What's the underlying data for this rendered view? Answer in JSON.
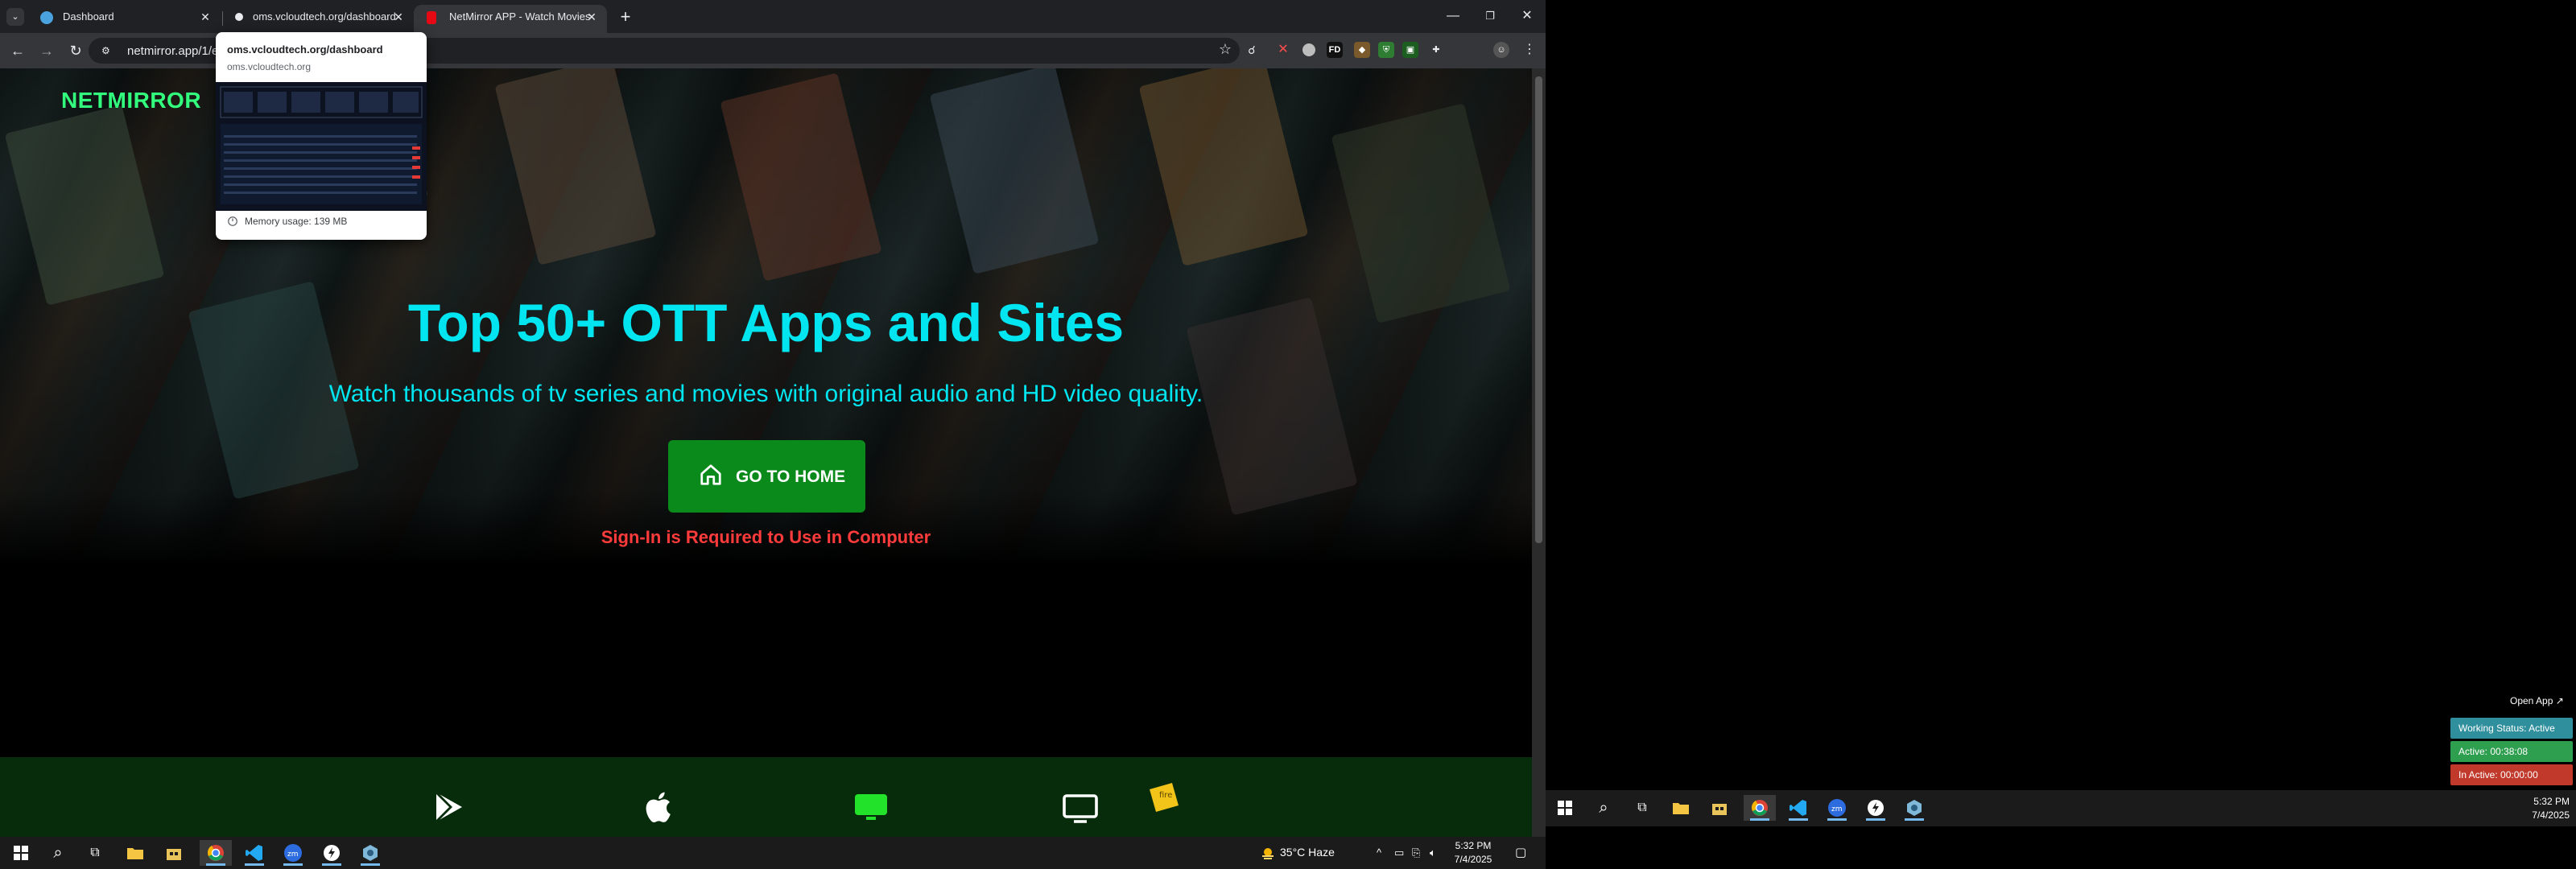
{
  "browser": {
    "tabs": [
      {
        "title": "Dashboard",
        "favicon_color": "#4aa3df",
        "active": false
      },
      {
        "title": "oms.vcloudtech.org/dashboard",
        "favicon_color": "#e8eaed",
        "active": false
      },
      {
        "title": "NetMirror APP - Watch Movies",
        "favicon_color": "#e50914",
        "active": true
      }
    ],
    "url": "netmirror.app/1/e",
    "hover_card": {
      "title": "oms.vcloudtech.org/dashboard",
      "domain": "oms.vcloudtech.org",
      "memory": "Memory usage: 139 MB"
    }
  },
  "page": {
    "brand": "NETMIRROR",
    "headline": "Top 50+ OTT Apps and Sites",
    "subline": "Watch thousands of tv series and movies with original audio and HD video quality.",
    "home_button": "GO TO HOME",
    "signin_note": "Sign-In is Required to Use in Computer",
    "colors": {
      "brand": "#32ff7e",
      "headline": "#00e5ef",
      "button": "#0b8a1c",
      "warning": "#ff3b3b",
      "app_bar": "#062c0b"
    },
    "app_icons": [
      "play-store-icon",
      "apple-icon",
      "android-tv-icon",
      "tv-icon",
      "fire-tv-icon"
    ]
  },
  "taskbar_left": {
    "weather": "35°C  Haze",
    "time": "5:32 PM",
    "date": "7/4/2025"
  },
  "taskbar_right": {
    "time": "5:32 PM",
    "date": "7/4/2025"
  },
  "tracker": {
    "open_app": "Open App ↗",
    "working_status": "Working Status: Active",
    "active": "Active: 00:38:08",
    "inactive": "In Active: 00:00:00",
    "colors": {
      "working": "#2f8f9d",
      "active": "#2e9e4f",
      "inactive": "#c0392b"
    }
  }
}
